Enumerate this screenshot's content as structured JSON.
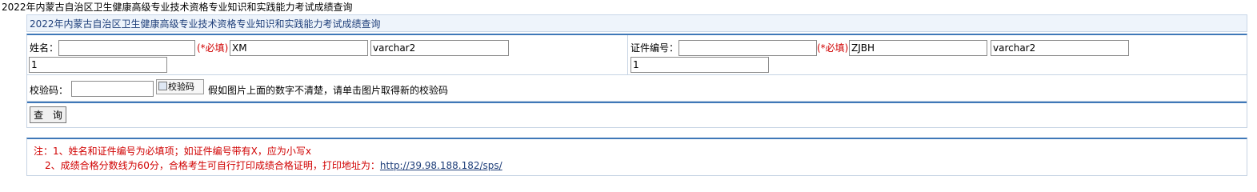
{
  "page": {
    "title": "2022年内蒙古自治区卫生健康高级专业技术资格专业知识和实践能力考试成绩查询"
  },
  "form": {
    "header": "2022年内蒙古自治区卫生健康高级专业技术资格专业知识和实践能力考试成绩查询",
    "name_field": {
      "label": "姓名：",
      "value": "",
      "required_note": "(*必填)",
      "field_code": "XM",
      "field_type": "varchar2",
      "extra": "1"
    },
    "id_field": {
      "label": "证件编号：",
      "value": "",
      "required_note": "(*必填)",
      "field_code": "ZJBH",
      "field_type": "varchar2",
      "extra": "1"
    },
    "captcha": {
      "label": "校验码：",
      "value": "",
      "image_alt": "校验码",
      "hint": "假如图片上面的数字不清楚，请单击图片取得新的校验码"
    },
    "query_button": "查 询"
  },
  "notes": {
    "line1": "注：1、姓名和证件编号为必填项；如证件编号带有X，应为小写x",
    "line2_prefix": "2、成绩合格分数线为60分，合格考生可自行打印成绩合格证明，打印地址为：",
    "line2_link": "http://39.98.188.182/sps/"
  }
}
